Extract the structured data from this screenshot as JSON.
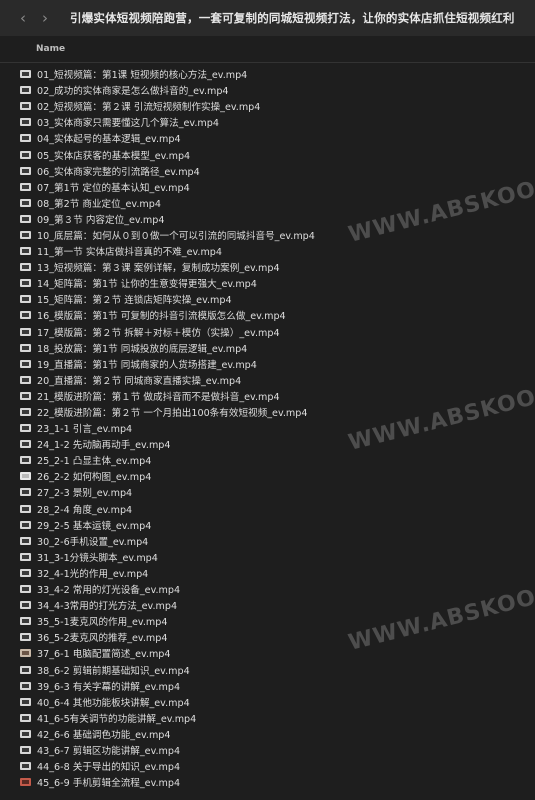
{
  "window": {
    "title": "引爆实体短视频陪跑营，一套可复制的同城短视频打法，让你的实体店抓住短视频红利"
  },
  "list_header": {
    "name": "Name"
  },
  "files": [
    {
      "name": "01_短视频篇：第1课 短视频的核心方法_ev.mp4",
      "icon": "dark"
    },
    {
      "name": "02_成功的实体商家是怎么做抖音的_ev.mp4",
      "icon": "dark"
    },
    {
      "name": "02_短视频篇：第２课 引流短视频制作实操_ev.mp4",
      "icon": "dark"
    },
    {
      "name": "03_实体商家只需要懂这几个算法_ev.mp4",
      "icon": "dark"
    },
    {
      "name": "04_实体起号的基本逻辑_ev.mp4",
      "icon": "dark"
    },
    {
      "name": "05_实体店获客的基本模型_ev.mp4",
      "icon": "dark"
    },
    {
      "name": "06_实体商家完整的引流路径_ev.mp4",
      "icon": "dark"
    },
    {
      "name": "07_第1节 定位的基本认知_ev.mp4",
      "icon": "dark"
    },
    {
      "name": "08_第2节 商业定位_ev.mp4",
      "icon": "dark"
    },
    {
      "name": "09_第３节 内容定位_ev.mp4",
      "icon": "dark"
    },
    {
      "name": "10_底层篇：如何从０到０做一个可以引流的同城抖音号_ev.mp4",
      "icon": "dark"
    },
    {
      "name": "11_第一节 实体店做抖音真的不难_ev.mp4",
      "icon": "dark"
    },
    {
      "name": "13_短视频篇：第３课 案例详解，复制成功案例_ev.mp4",
      "icon": "dark"
    },
    {
      "name": "14_矩阵篇：第1节 让你的生意变得更强大_ev.mp4",
      "icon": "dark"
    },
    {
      "name": "15_矩阵篇：第２节 连锁店矩阵实操_ev.mp4",
      "icon": "dark"
    },
    {
      "name": "16_模版篇：第1节 可复制的抖音引流模版怎么做_ev.mp4",
      "icon": "dark"
    },
    {
      "name": "17_模版篇：第２节 拆解＋对标＋模仿（实操）_ev.mp4",
      "icon": "dark"
    },
    {
      "name": "18_投放篇：第1节 同城投放的底层逻辑_ev.mp4",
      "icon": "dark"
    },
    {
      "name": "19_直播篇：第1节 同城商家的人货场搭建_ev.mp4",
      "icon": "dark"
    },
    {
      "name": "20_直播篇：第２节 同城商家直播实操_ev.mp4",
      "icon": "dark"
    },
    {
      "name": "21_模版进阶篇：第１节 做成抖音而不是做抖音_ev.mp4",
      "icon": "dark"
    },
    {
      "name": "22_模版进阶篇：第２节 一个月拍出100条有效短视频_ev.mp4",
      "icon": "dark"
    },
    {
      "name": "23_1-1 引言_ev.mp4",
      "icon": "dark"
    },
    {
      "name": "24_1-2 先动脑再动手_ev.mp4",
      "icon": "dark"
    },
    {
      "name": "25_2-1 凸显主体_ev.mp4",
      "icon": "dark"
    },
    {
      "name": "26_2-2 如何构图_ev.mp4",
      "icon": "light"
    },
    {
      "name": "27_2-3 景别_ev.mp4",
      "icon": "dark"
    },
    {
      "name": "28_2-4 角度_ev.mp4",
      "icon": "dark"
    },
    {
      "name": "29_2-5 基本运镜_ev.mp4",
      "icon": "dark"
    },
    {
      "name": "30_2-6手机设置_ev.mp4",
      "icon": "dark"
    },
    {
      "name": "31_3-1分镜头脚本_ev.mp4",
      "icon": "dark"
    },
    {
      "name": "32_4-1光的作用_ev.mp4",
      "icon": "dark"
    },
    {
      "name": "33_4-2 常用的灯光设备_ev.mp4",
      "icon": "dark"
    },
    {
      "name": "34_4-3常用的打光方法_ev.mp4",
      "icon": "dark"
    },
    {
      "name": "35_5-1麦克风的作用_ev.mp4",
      "icon": "dark"
    },
    {
      "name": "36_5-2麦克风的推荐_ev.mp4",
      "icon": "dark"
    },
    {
      "name": "37_6-1 电脑配置简述_ev.mp4",
      "icon": "warm"
    },
    {
      "name": "38_6-2 剪辑前期基础知识_ev.mp4",
      "icon": "dark"
    },
    {
      "name": "39_6-3 有关字幕的讲解_ev.mp4",
      "icon": "dark"
    },
    {
      "name": "40_6-4 其他功能板块讲解_ev.mp4",
      "icon": "dark"
    },
    {
      "name": "41_6-5有关调节的功能讲解_ev.mp4",
      "icon": "dark"
    },
    {
      "name": "42_6-6 基础调色功能_ev.mp4",
      "icon": "dark"
    },
    {
      "name": "43_6-7 剪辑区功能讲解_ev.mp4",
      "icon": "dark"
    },
    {
      "name": "44_6-8 关于导出的知识_ev.mp4",
      "icon": "dark"
    },
    {
      "name": "45_6-9 手机剪辑全流程_ev.mp4",
      "icon": "red"
    }
  ],
  "watermark": "WWW.ABSKOOP.COM"
}
